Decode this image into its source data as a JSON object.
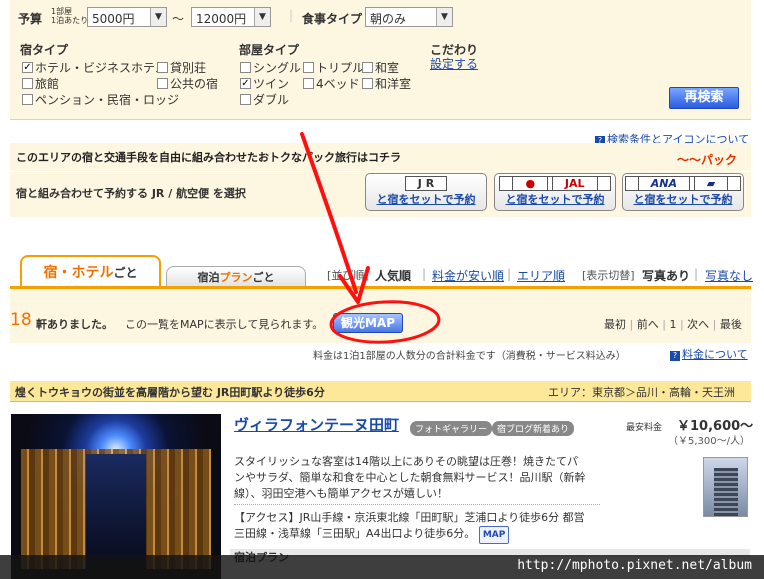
{
  "search": {
    "budget_label": "予算",
    "budget_sub1": "1部屋",
    "budget_sub2": "1泊あたり",
    "budget_min": "5000円",
    "range_sep": "〜",
    "budget_max": "12000円",
    "meal_label": "食事タイプ",
    "meal_value": "朝のみ",
    "inn_type_label": "宿タイプ",
    "inn_types": [
      {
        "label": "ホテル・ビジネスホテル",
        "checked": true
      },
      {
        "label": "貸別荘",
        "checked": false
      },
      {
        "label": "旅館",
        "checked": false
      },
      {
        "label": "公共の宿",
        "checked": false
      },
      {
        "label": "ペンション・民宿・ロッジ",
        "checked": false
      }
    ],
    "room_type_label": "部屋タイプ",
    "room_types": [
      {
        "label": "シングル",
        "checked": false
      },
      {
        "label": "トリプル",
        "checked": false
      },
      {
        "label": "和室",
        "checked": false
      },
      {
        "label": "ツイン",
        "checked": true
      },
      {
        "label": "4ベッド",
        "checked": false
      },
      {
        "label": "和洋室",
        "checked": false
      },
      {
        "label": "ダブル",
        "checked": false
      }
    ],
    "kodawari_label": "こだわり",
    "kodawari_link": "設定する",
    "research_button": "再検索"
  },
  "pack": {
    "help_link": "検索条件とアイコンについて",
    "headline": "このエリアの宿と交通手段を自由に組み合わせたおトクなパック旅行はコチラ",
    "brand": "パック",
    "select_text": "宿と組み合わせて予約する JR / 航空便 を選択",
    "carriers": [
      {
        "logo": "J R",
        "link": "と宿をセットで予約"
      },
      {
        "logo": "JAL",
        "link": "と宿をセットで予約"
      },
      {
        "logo": "ANA",
        "link": "と宿をセットで予約"
      }
    ]
  },
  "tabs": {
    "tab1_main": "宿・ホテル",
    "tab1_suffix": "ごと",
    "tab2_prefix": "宿泊",
    "tab2_main": "プラン",
    "tab2_suffix": "ごと"
  },
  "sort": {
    "label_partial": "[並び順]",
    "popular": "人気順",
    "cheap": "料金が安い順",
    "area": "エリア順",
    "toggle_label": "[表示切替]",
    "photo_on": "写真あり",
    "photo_off": "写真なし"
  },
  "results": {
    "count": "18",
    "count_suffix": "軒ありました。",
    "map_note": "この一覧をMAPに表示して見られます。",
    "kanko_button": "観光MAP",
    "pager": [
      "最初",
      "前へ",
      "1",
      "次へ",
      "最後"
    ],
    "price_note": "料金は1泊1部屋の人数分の合計料金です（消費税・サービス料込み）",
    "price_link": "料金について"
  },
  "hotel": {
    "catch": "煌くトウキョウの街並を高層階から望む JR田町駅より徒歩6分",
    "area": "エリア：東京都＞品川・高輪・天王洲",
    "name": "ヴィラフォンテーヌ田町",
    "badge_photo": "フォトギャラリー",
    "badge_blog": "宿ブログ新着あり",
    "min_price_label": "最安料金",
    "min_price": "￥10,600〜",
    "per_person": "（￥5,300〜/人）",
    "desc": [
      "スタイリッシュな客室は14階以上にありその眺望は圧巻！焼きたてパ",
      "ンやサラダ、簡単な和食を中心とした朝食無料サービス！品川駅（新幹",
      "線）、羽田空港へも簡単アクセスが嬉しい！"
    ],
    "access_1": "【アクセス】JR山手線・京浜東北線「田町駅」芝浦口より徒歩6分 都営",
    "access_2": "三田線・浅草線「三田駅」A4出口より徒歩6分。",
    "map_button": "MAP",
    "plan_label": "宿泊プラン"
  },
  "watermark": "http://mphoto.pixnet.net/album",
  "annotation_color": "#ff1010"
}
